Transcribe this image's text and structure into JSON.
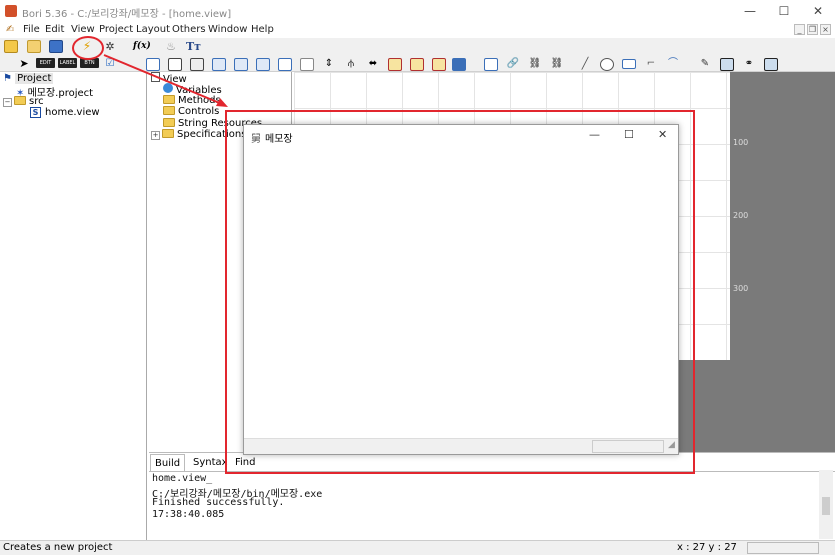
{
  "window": {
    "title": "Bori 5.36 - C:/보리강좌/메모장 - [home.view]",
    "minimize": "—",
    "maximize": "☐",
    "close": "✕"
  },
  "menu": [
    "File",
    "Edit",
    "View",
    "Project",
    "Layout",
    "Others",
    "Window",
    "Help"
  ],
  "mdi": {
    "min": "_",
    "restore": "❐",
    "close": "×"
  },
  "toolbar2_labels": {
    "edit": "EDIT",
    "label": "LABEL",
    "btn": "BTN"
  },
  "project_tree": {
    "root": "Project",
    "project_file": "메모장.project",
    "src": "src",
    "view_file": "home.view"
  },
  "view_tree": {
    "root": "View",
    "items": [
      "Variables",
      "Methods",
      "Controls",
      "String Resources",
      "Specifications"
    ]
  },
  "ruler": [
    "100",
    "200",
    "300"
  ],
  "memo_window": {
    "title": "메모장",
    "icon": "舅",
    "minimize": "—",
    "maximize": "☐",
    "close": "✕"
  },
  "bottom_tabs": [
    "Build",
    "Syntax",
    "Find"
  ],
  "output_lines": [
    "home.view_",
    "C:/보리강좌/메모장/bin/메모장.exe",
    "Finished successfully.",
    "17:38:40.085"
  ],
  "status": {
    "message": "Creates a new project",
    "coords": "x : 27  y : 27"
  },
  "colors": {
    "accent_red": "#e2262e",
    "canvas_bg": "#7a7a7a",
    "folder": "#f2cc55"
  }
}
